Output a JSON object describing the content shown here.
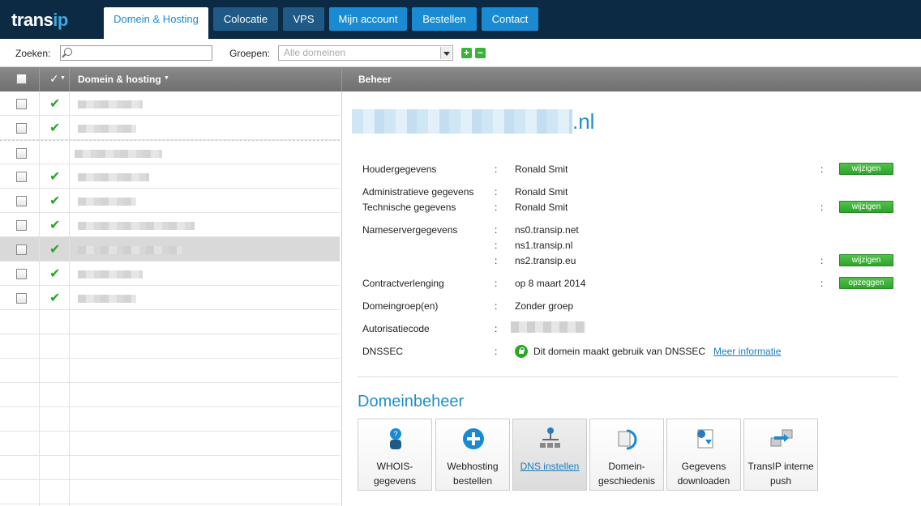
{
  "brand": {
    "logo_part1": "trans",
    "logo_part2": "ip"
  },
  "nav": {
    "tabs": [
      "Domein & Hosting",
      "Colocatie",
      "VPS",
      "Mijn account",
      "Bestellen",
      "Contact"
    ]
  },
  "search": {
    "label": "Zoeken:",
    "groups_label": "Groepen:",
    "groups_selected": "Alle domeinen",
    "add": "+",
    "remove": "−"
  },
  "columns": {
    "check_header": "✓",
    "domain_header": "Domein & hosting",
    "manage_header": "Beheer"
  },
  "list": {
    "rows": [
      {
        "checked": true
      },
      {
        "checked": true
      },
      {
        "checked": false
      },
      {
        "checked": true
      },
      {
        "checked": true
      },
      {
        "checked": true
      },
      {
        "checked": true
      },
      {
        "checked": true
      },
      {
        "checked": true
      }
    ]
  },
  "detail": {
    "domain_suffix": ".nl",
    "holder_label": "Houdergegevens",
    "holder_value": "Ronald Smit",
    "admin_label": "Administratieve gegevens",
    "admin_value": "Ronald Smit",
    "tech_label": "Technische gegevens",
    "tech_value": "Ronald Smit",
    "ns_label": "Nameservergegevens",
    "ns1": "ns0.transip.net",
    "ns2": "ns1.transip.nl",
    "ns3": "ns2.transip.eu",
    "contract_label": "Contractverlenging",
    "contract_value": "op 8 maart 2014",
    "group_label": "Domeingroep(en)",
    "group_value": "Zonder groep",
    "auth_label": "Autorisatiecode",
    "dnssec_label": "DNSSEC",
    "dnssec_value": "Dit domein maakt gebruik van DNSSEC",
    "dnssec_link": "Meer informatie",
    "colon": ":",
    "btn_change": "wijzigen",
    "btn_cancel": "opzeggen"
  },
  "management": {
    "title": "Domeinbeheer",
    "tiles": [
      {
        "line1": "WHOIS-",
        "line2": "gegevens"
      },
      {
        "line1": "Webhosting",
        "line2": "bestellen"
      },
      {
        "line1": "DNS instellen",
        "line2": ""
      },
      {
        "line1": "Domein-",
        "line2": "geschiedenis"
      },
      {
        "line1": "Gegevens",
        "line2": "downloaden"
      },
      {
        "line1": "TransIP interne",
        "line2": "push"
      }
    ]
  }
}
